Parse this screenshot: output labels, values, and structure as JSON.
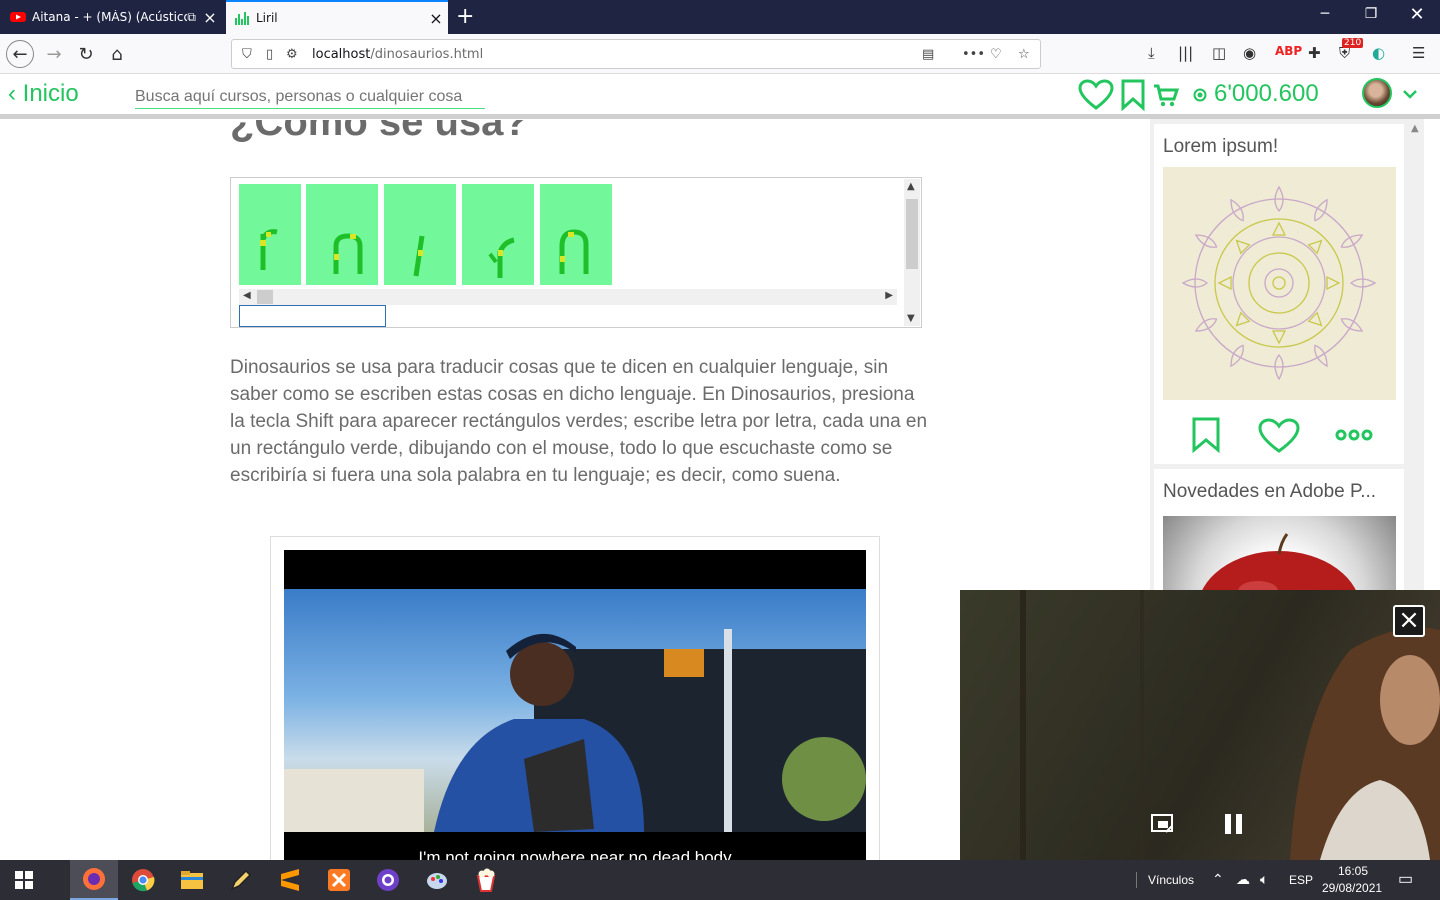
{
  "browser": {
    "tabs": [
      {
        "title": "Aitana - + (MÁS) (Acústico)",
        "active": false
      },
      {
        "title": "Liril",
        "active": true
      }
    ],
    "url_host": "localhost",
    "url_path": "/dinosaurios.html",
    "toolbar_badge": "210"
  },
  "header": {
    "back_label": "‹ Inicio",
    "search_placeholder": "Busca aquí cursos, personas o cualquier cosa",
    "coins": "6'000.600"
  },
  "main": {
    "title": "¿Cómo se usa?",
    "letter_count": 5,
    "description": "Dinosaurios se usa para traducir cosas que te dicen en cualquier lenguaje, sin saber como se escriben estas cosas en dicho lenguaje. En Dinosaurios, presiona la tecla Shift para aparecer rectángulos verdes; escribe letra por letra, cada una en un rectángulo verde, dibujando con el mouse, todo lo que escuchaste como se escribiría si fuera una sola palabra en tu lenguaje; es decir, como suena.",
    "video_subtitle": "I'm not going nowhere near no dead body"
  },
  "sidebar": {
    "cards": [
      {
        "title": "Lorem ipsum!"
      },
      {
        "title": "Novedades en Adobe P..."
      }
    ]
  },
  "taskbar": {
    "links_label": "Vínculos",
    "language": "ESP",
    "time": "16:05",
    "date": "29/08/2021"
  },
  "colors": {
    "accent": "#22c55e",
    "letter_box": "#72f89a",
    "tabstrip": "#1f2443"
  }
}
